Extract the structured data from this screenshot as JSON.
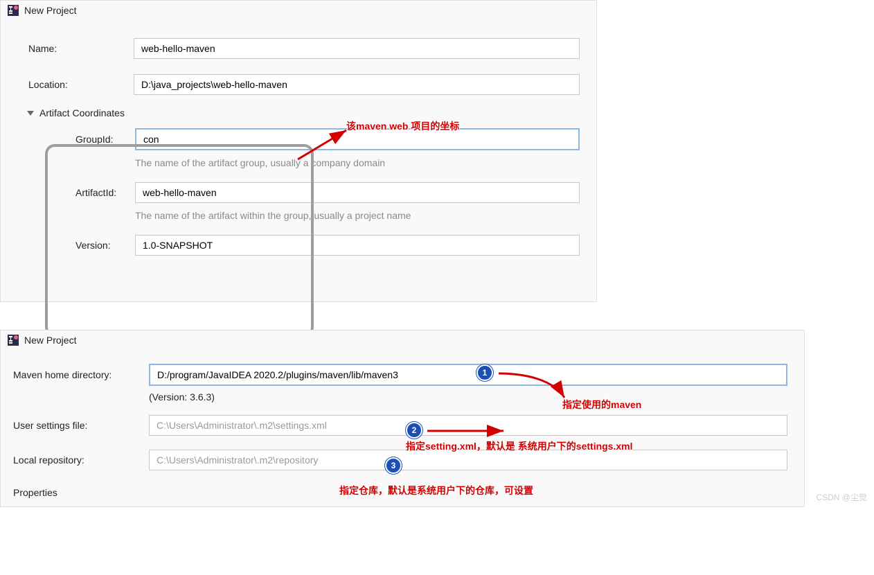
{
  "panel1": {
    "title": "New Project",
    "name_label": "Name:",
    "name_value": "web-hello-maven",
    "location_label": "Location:",
    "location_value": "D:\\java_projects\\web-hello-maven",
    "artifact_header": "Artifact Coordinates",
    "group_label": "GroupId:",
    "group_value": "con",
    "group_hint": "The name of the artifact group, usually a company domain",
    "artifact_label": "ArtifactId:",
    "artifact_value": "web-hello-maven",
    "artifact_hint": "The name of the artifact within the group, usually a project name",
    "version_label": "Version:",
    "version_value": "1.0-SNAPSHOT",
    "annot1": "该maven web 项目的坐标"
  },
  "panel2": {
    "title": "New Project",
    "maven_home_label": "Maven home directory:",
    "maven_home_value": "D:/program/JavaIDEA 2020.2/plugins/maven/lib/maven3",
    "maven_version": "(Version: 3.6.3)",
    "user_settings_label": "User settings file:",
    "user_settings_value": "C:\\Users\\Administrator\\.m2\\settings.xml",
    "local_repo_label": "Local repository:",
    "local_repo_value": "C:\\Users\\Administrator\\.m2\\repository",
    "properties_label": "Properties",
    "badge1": "1",
    "badge2": "2",
    "badge3": "3",
    "annot1": "指定使用的maven",
    "annot2": "指定setting.xml，默认是 系统用户下的settings.xml",
    "annot3": "指定仓库，默认是系统用户下的仓库，可设置"
  },
  "watermark": "CSDN @尘觉"
}
